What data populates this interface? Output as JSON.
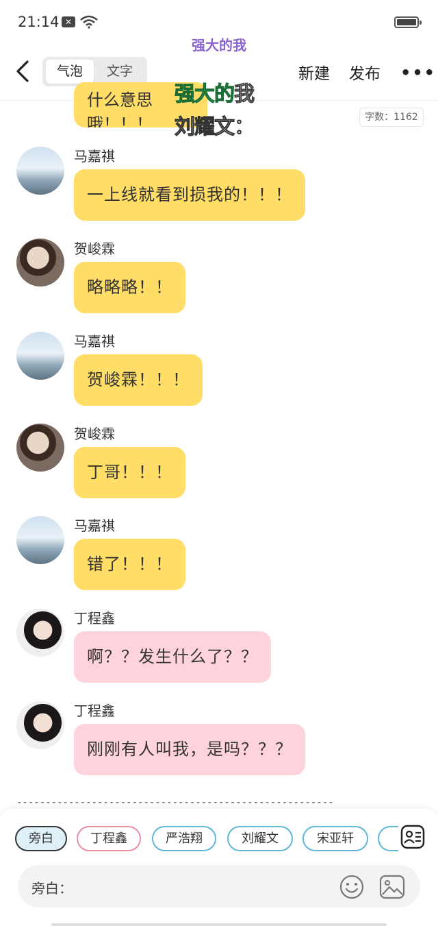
{
  "status_bar": {
    "time": "21:14",
    "notification_glyph": "✕"
  },
  "story_title": "强大的我",
  "toolbar": {
    "mode_bubble": "气泡",
    "mode_text": "文字",
    "new_label": "新建",
    "publish_label": "发布",
    "more_label": "•••"
  },
  "overlay": {
    "title_green": "强大的",
    "title_rest": "我",
    "subtitle": "刘耀文："
  },
  "word_count": "字数：1162",
  "partial_message": "什么意思哦！！！",
  "messages": [
    {
      "speaker": "马嘉祺",
      "text": "一上线就看到损我的！！！",
      "color": "yellow"
    },
    {
      "speaker": "贺峻霖",
      "text": "略略略！！",
      "color": "yellow"
    },
    {
      "speaker": "马嘉祺",
      "text": "贺峻霖！！！",
      "color": "yellow"
    },
    {
      "speaker": "贺峻霖",
      "text": "丁哥！！！",
      "color": "yellow"
    },
    {
      "speaker": "马嘉祺",
      "text": "错了！！！",
      "color": "yellow"
    },
    {
      "speaker": "丁程鑫",
      "text": "啊？？发生什么了？？",
      "color": "pink"
    },
    {
      "speaker": "丁程鑫",
      "text": "刚刚有人叫我，是吗？？？",
      "color": "pink"
    }
  ],
  "separator": "------------------------------------------------------------",
  "characters": [
    "旁白",
    "丁程鑫",
    "严浩翔",
    "刘耀文",
    "宋亚轩"
  ],
  "input": {
    "label": "旁白："
  },
  "colors": {
    "bubble_yellow": "#ffdd66",
    "bubble_pink": "#ffd3dc",
    "title_purple": "#8a63cf",
    "chip_blue": "#5fb8d8",
    "chip_pink": "#e88ea1"
  }
}
